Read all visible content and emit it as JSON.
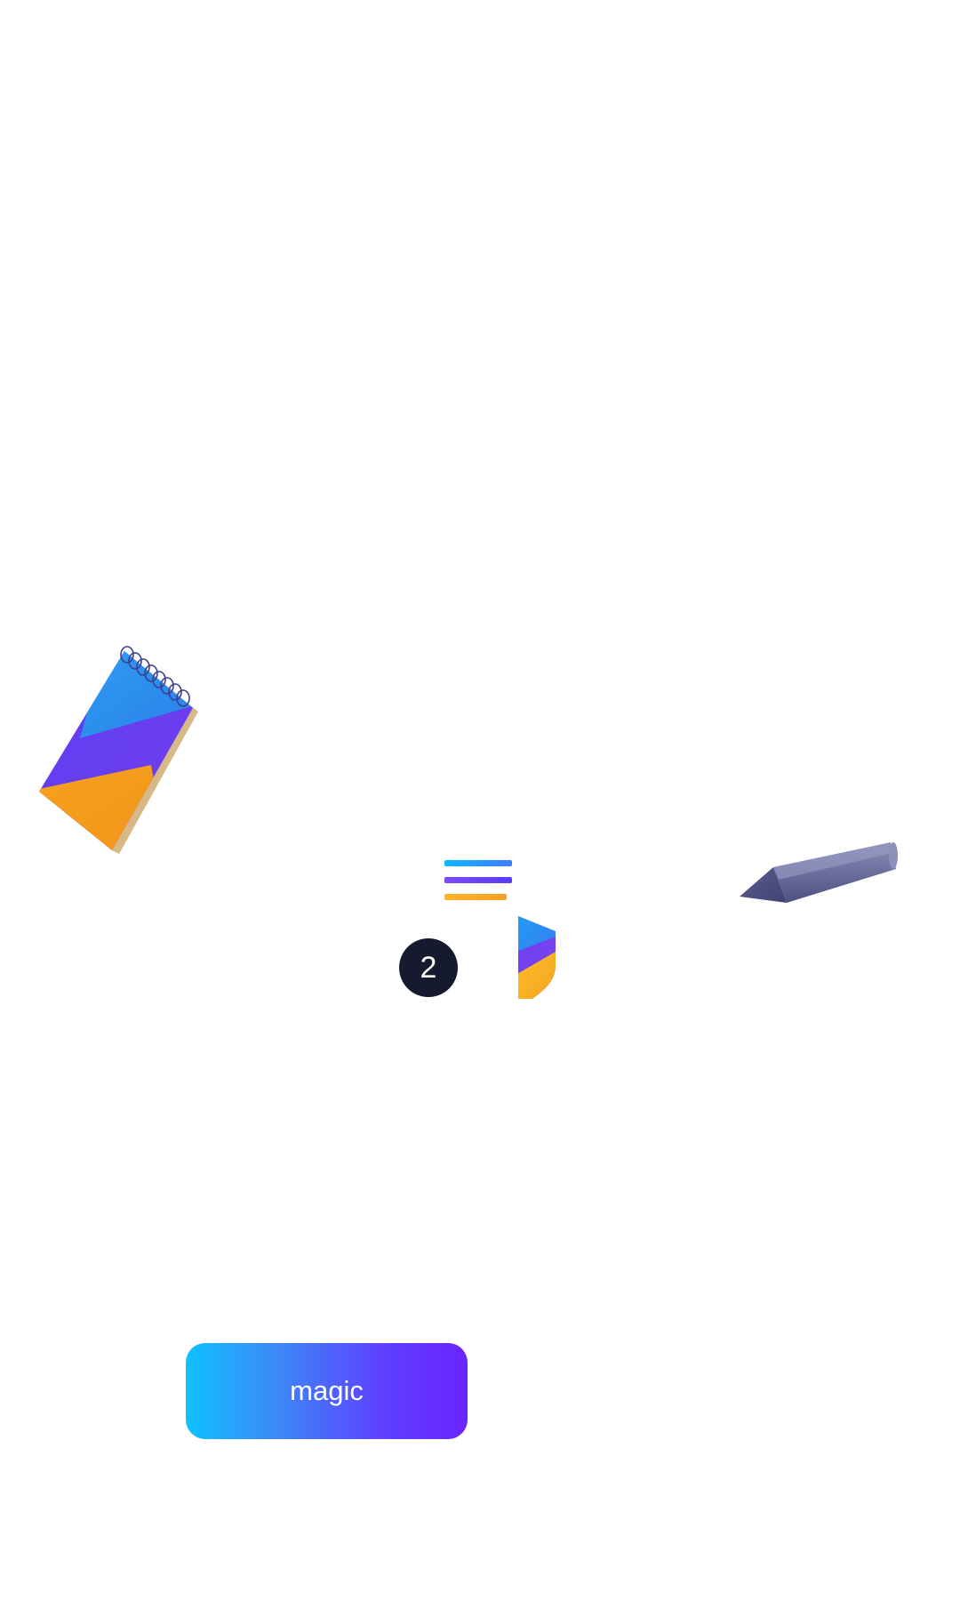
{
  "step_badge": {
    "label": "2"
  },
  "magic_button": {
    "label": "magic"
  },
  "illustrations": {
    "notebook": "notebook-icon",
    "pencil": "pencil-icon",
    "menu": "menu-lines-icon",
    "shield": "shield-icon"
  },
  "colors": {
    "gradient_start": "#0ec2ff",
    "gradient_end": "#6a24ff",
    "badge_bg": "#151a2e",
    "notebook_blue": "#2e8ef0",
    "notebook_purple": "#6a3cf0",
    "notebook_orange": "#f59e1e",
    "pencil_body": "#6b6f99"
  }
}
